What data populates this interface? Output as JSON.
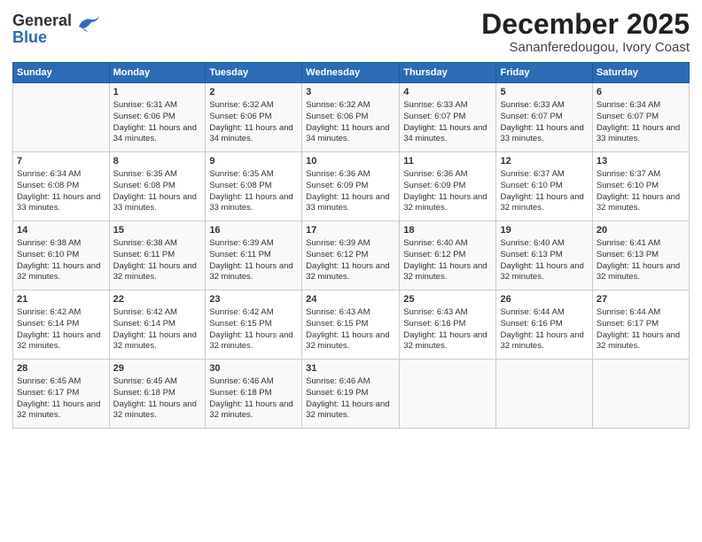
{
  "header": {
    "logo_general": "General",
    "logo_blue": "Blue",
    "month": "December 2025",
    "location": "Sananferedougou, Ivory Coast"
  },
  "days_of_week": [
    "Sunday",
    "Monday",
    "Tuesday",
    "Wednesday",
    "Thursday",
    "Friday",
    "Saturday"
  ],
  "weeks": [
    [
      {
        "day": "",
        "sunrise": "",
        "sunset": "",
        "daylight": ""
      },
      {
        "day": "1",
        "sunrise": "Sunrise: 6:31 AM",
        "sunset": "Sunset: 6:06 PM",
        "daylight": "Daylight: 11 hours and 34 minutes."
      },
      {
        "day": "2",
        "sunrise": "Sunrise: 6:32 AM",
        "sunset": "Sunset: 6:06 PM",
        "daylight": "Daylight: 11 hours and 34 minutes."
      },
      {
        "day": "3",
        "sunrise": "Sunrise: 6:32 AM",
        "sunset": "Sunset: 6:06 PM",
        "daylight": "Daylight: 11 hours and 34 minutes."
      },
      {
        "day": "4",
        "sunrise": "Sunrise: 6:33 AM",
        "sunset": "Sunset: 6:07 PM",
        "daylight": "Daylight: 11 hours and 34 minutes."
      },
      {
        "day": "5",
        "sunrise": "Sunrise: 6:33 AM",
        "sunset": "Sunset: 6:07 PM",
        "daylight": "Daylight: 11 hours and 33 minutes."
      },
      {
        "day": "6",
        "sunrise": "Sunrise: 6:34 AM",
        "sunset": "Sunset: 6:07 PM",
        "daylight": "Daylight: 11 hours and 33 minutes."
      }
    ],
    [
      {
        "day": "7",
        "sunrise": "Sunrise: 6:34 AM",
        "sunset": "Sunset: 6:08 PM",
        "daylight": "Daylight: 11 hours and 33 minutes."
      },
      {
        "day": "8",
        "sunrise": "Sunrise: 6:35 AM",
        "sunset": "Sunset: 6:08 PM",
        "daylight": "Daylight: 11 hours and 33 minutes."
      },
      {
        "day": "9",
        "sunrise": "Sunrise: 6:35 AM",
        "sunset": "Sunset: 6:08 PM",
        "daylight": "Daylight: 11 hours and 33 minutes."
      },
      {
        "day": "10",
        "sunrise": "Sunrise: 6:36 AM",
        "sunset": "Sunset: 6:09 PM",
        "daylight": "Daylight: 11 hours and 33 minutes."
      },
      {
        "day": "11",
        "sunrise": "Sunrise: 6:36 AM",
        "sunset": "Sunset: 6:09 PM",
        "daylight": "Daylight: 11 hours and 32 minutes."
      },
      {
        "day": "12",
        "sunrise": "Sunrise: 6:37 AM",
        "sunset": "Sunset: 6:10 PM",
        "daylight": "Daylight: 11 hours and 32 minutes."
      },
      {
        "day": "13",
        "sunrise": "Sunrise: 6:37 AM",
        "sunset": "Sunset: 6:10 PM",
        "daylight": "Daylight: 11 hours and 32 minutes."
      }
    ],
    [
      {
        "day": "14",
        "sunrise": "Sunrise: 6:38 AM",
        "sunset": "Sunset: 6:10 PM",
        "daylight": "Daylight: 11 hours and 32 minutes."
      },
      {
        "day": "15",
        "sunrise": "Sunrise: 6:38 AM",
        "sunset": "Sunset: 6:11 PM",
        "daylight": "Daylight: 11 hours and 32 minutes."
      },
      {
        "day": "16",
        "sunrise": "Sunrise: 6:39 AM",
        "sunset": "Sunset: 6:11 PM",
        "daylight": "Daylight: 11 hours and 32 minutes."
      },
      {
        "day": "17",
        "sunrise": "Sunrise: 6:39 AM",
        "sunset": "Sunset: 6:12 PM",
        "daylight": "Daylight: 11 hours and 32 minutes."
      },
      {
        "day": "18",
        "sunrise": "Sunrise: 6:40 AM",
        "sunset": "Sunset: 6:12 PM",
        "daylight": "Daylight: 11 hours and 32 minutes."
      },
      {
        "day": "19",
        "sunrise": "Sunrise: 6:40 AM",
        "sunset": "Sunset: 6:13 PM",
        "daylight": "Daylight: 11 hours and 32 minutes."
      },
      {
        "day": "20",
        "sunrise": "Sunrise: 6:41 AM",
        "sunset": "Sunset: 6:13 PM",
        "daylight": "Daylight: 11 hours and 32 minutes."
      }
    ],
    [
      {
        "day": "21",
        "sunrise": "Sunrise: 6:42 AM",
        "sunset": "Sunset: 6:14 PM",
        "daylight": "Daylight: 11 hours and 32 minutes."
      },
      {
        "day": "22",
        "sunrise": "Sunrise: 6:42 AM",
        "sunset": "Sunset: 6:14 PM",
        "daylight": "Daylight: 11 hours and 32 minutes."
      },
      {
        "day": "23",
        "sunrise": "Sunrise: 6:42 AM",
        "sunset": "Sunset: 6:15 PM",
        "daylight": "Daylight: 11 hours and 32 minutes."
      },
      {
        "day": "24",
        "sunrise": "Sunrise: 6:43 AM",
        "sunset": "Sunset: 6:15 PM",
        "daylight": "Daylight: 11 hours and 32 minutes."
      },
      {
        "day": "25",
        "sunrise": "Sunrise: 6:43 AM",
        "sunset": "Sunset: 6:16 PM",
        "daylight": "Daylight: 11 hours and 32 minutes."
      },
      {
        "day": "26",
        "sunrise": "Sunrise: 6:44 AM",
        "sunset": "Sunset: 6:16 PM",
        "daylight": "Daylight: 11 hours and 32 minutes."
      },
      {
        "day": "27",
        "sunrise": "Sunrise: 6:44 AM",
        "sunset": "Sunset: 6:17 PM",
        "daylight": "Daylight: 11 hours and 32 minutes."
      }
    ],
    [
      {
        "day": "28",
        "sunrise": "Sunrise: 6:45 AM",
        "sunset": "Sunset: 6:17 PM",
        "daylight": "Daylight: 11 hours and 32 minutes."
      },
      {
        "day": "29",
        "sunrise": "Sunrise: 6:45 AM",
        "sunset": "Sunset: 6:18 PM",
        "daylight": "Daylight: 11 hours and 32 minutes."
      },
      {
        "day": "30",
        "sunrise": "Sunrise: 6:46 AM",
        "sunset": "Sunset: 6:18 PM",
        "daylight": "Daylight: 11 hours and 32 minutes."
      },
      {
        "day": "31",
        "sunrise": "Sunrise: 6:46 AM",
        "sunset": "Sunset: 6:19 PM",
        "daylight": "Daylight: 11 hours and 32 minutes."
      },
      {
        "day": "",
        "sunrise": "",
        "sunset": "",
        "daylight": ""
      },
      {
        "day": "",
        "sunrise": "",
        "sunset": "",
        "daylight": ""
      },
      {
        "day": "",
        "sunrise": "",
        "sunset": "",
        "daylight": ""
      }
    ]
  ]
}
